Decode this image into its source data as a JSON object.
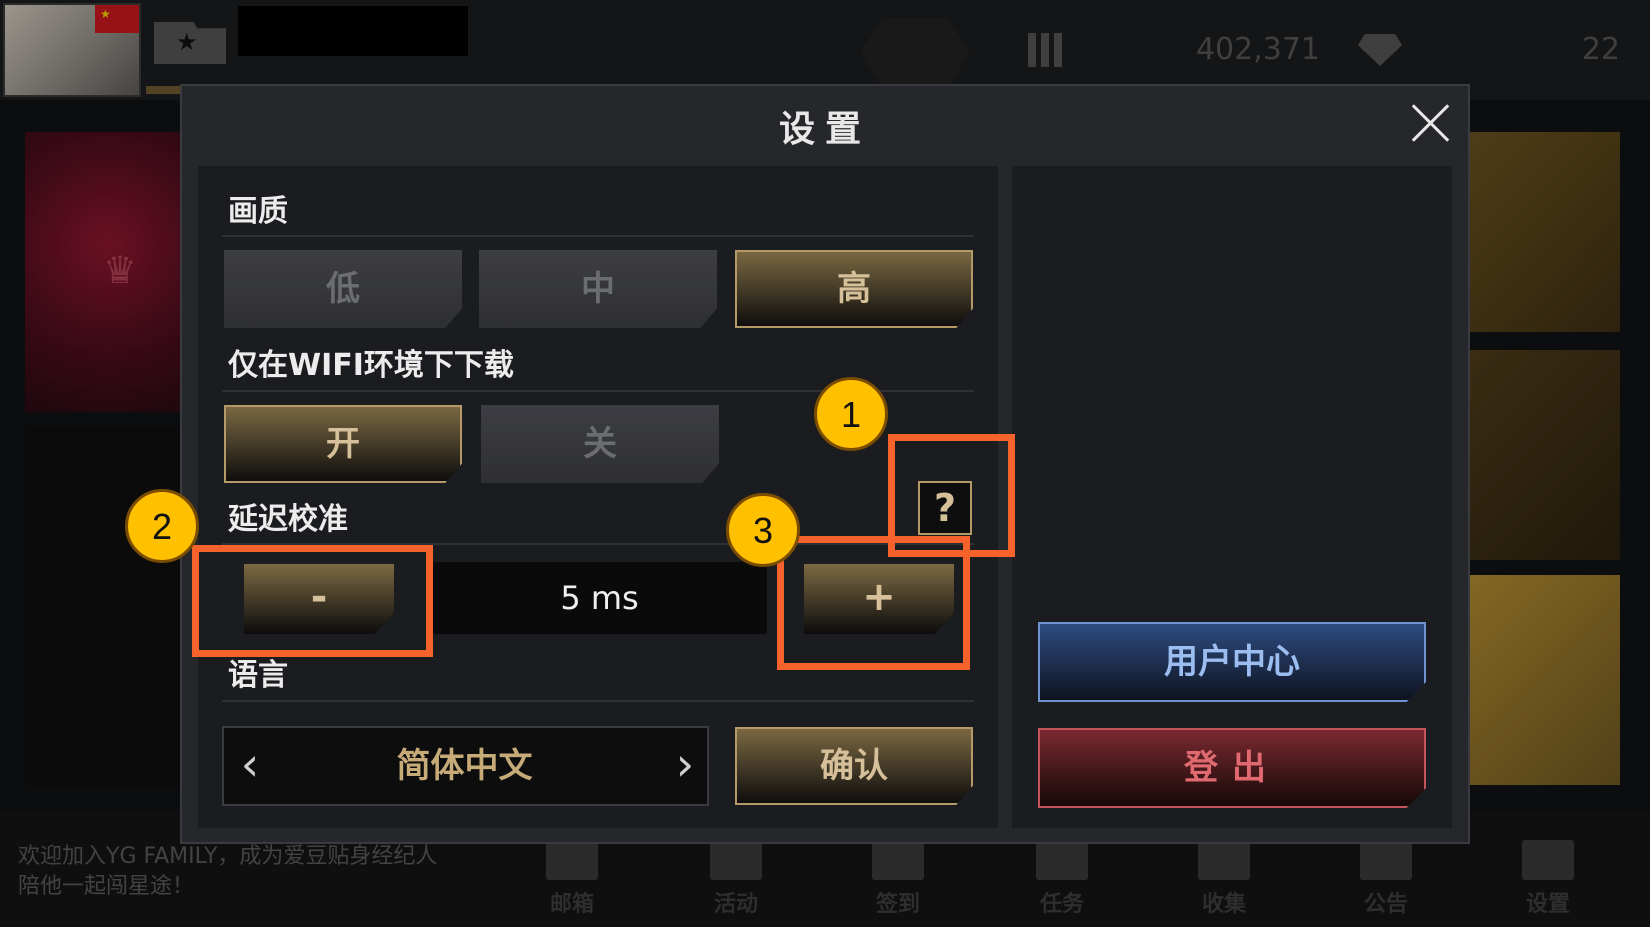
{
  "topbar": {
    "coins": "402,371",
    "diamonds": "22",
    "icons": [
      "avatar",
      "china-flag-icon",
      "star-badge-icon",
      "emblem-icon",
      "cards-icon",
      "diamond-icon"
    ]
  },
  "dialog": {
    "title": "设置",
    "quality": {
      "label": "画质",
      "options": [
        "低",
        "中",
        "高"
      ],
      "selected": "高"
    },
    "wifi": {
      "label": "仅在WIFI环境下下载",
      "on": "开",
      "off": "关",
      "selected": "开"
    },
    "delay": {
      "label": "延迟校准",
      "minus": "-",
      "plus": "+",
      "value": "5 ms",
      "help": "?"
    },
    "language": {
      "label": "语言",
      "value": "简体中文",
      "prev": "‹",
      "next": "›",
      "confirm": "确认"
    },
    "user_center": "用户中心",
    "logout": "登出"
  },
  "annotations": {
    "markers": [
      "1",
      "2",
      "3"
    ],
    "highlight_color": "#f5622c",
    "marker_color": "#ffc000"
  },
  "bottombar": {
    "welcome": "欢迎加入YG FAMILY，成为爱豆贴身经纪人陪他一起闯星途！",
    "nav": [
      "邮箱",
      "活动",
      "签到",
      "任务",
      "收集",
      "公告",
      "设置"
    ]
  }
}
